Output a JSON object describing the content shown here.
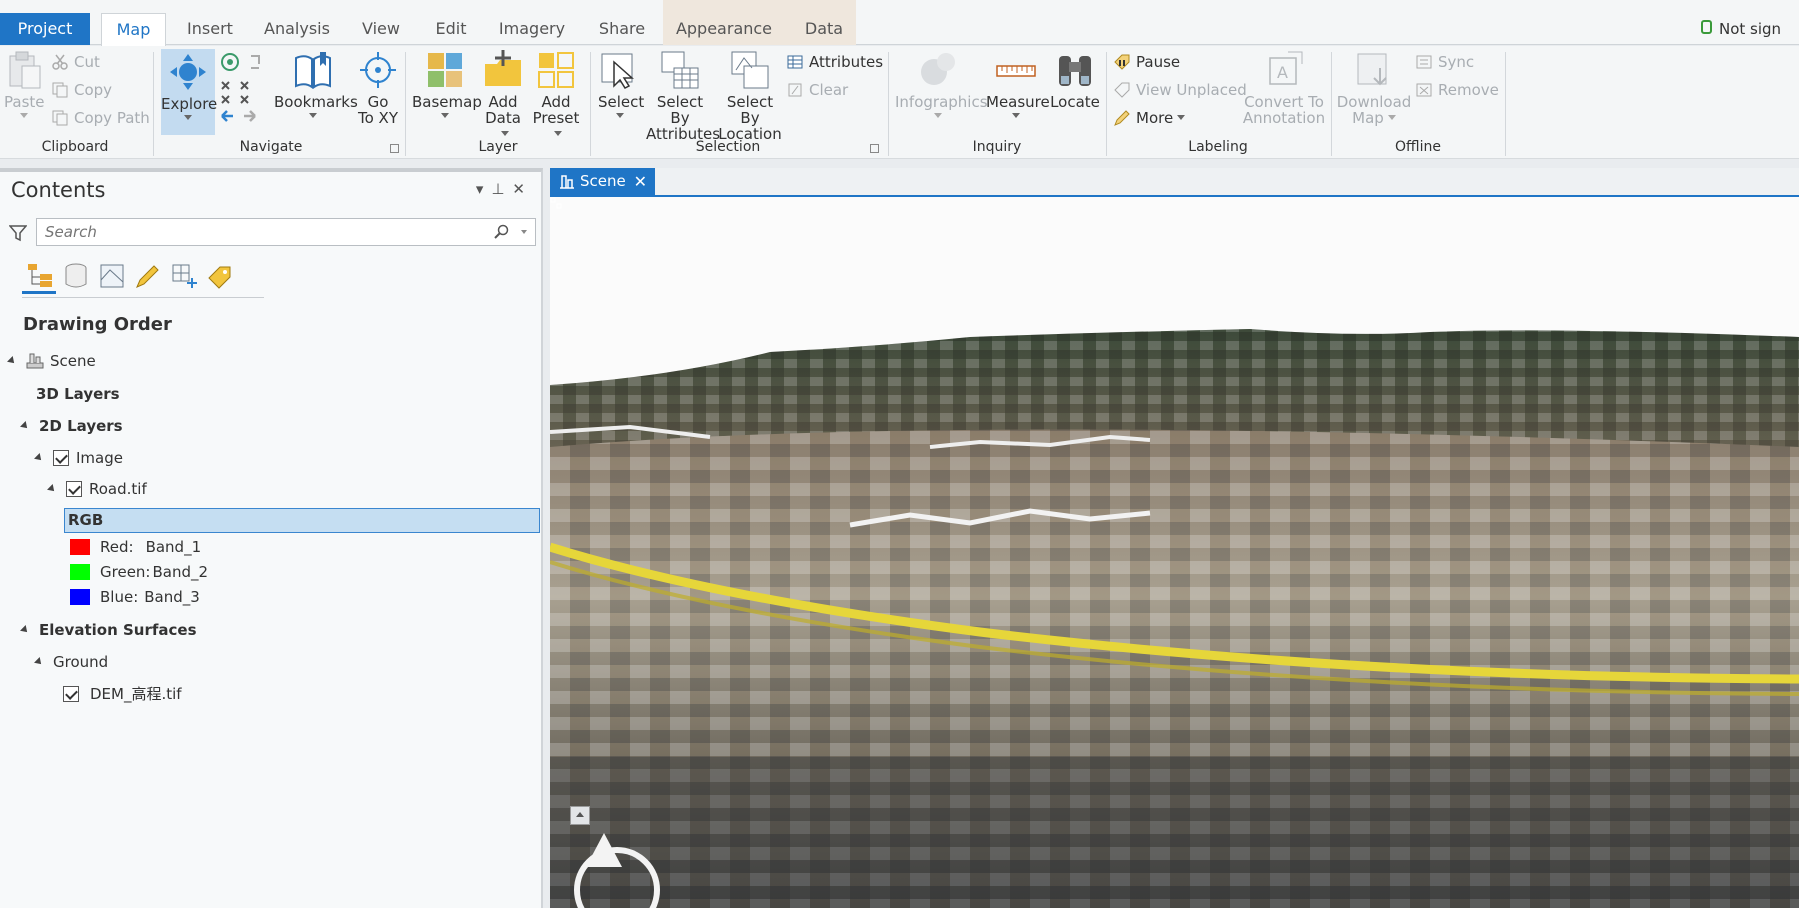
{
  "ribbon_tabs": {
    "project": "Project",
    "map": "Map",
    "insert": "Insert",
    "analysis": "Analysis",
    "view": "View",
    "edit": "Edit",
    "imagery": "Imagery",
    "share": "Share",
    "appearance": "Appearance",
    "data": "Data",
    "signin": "Not sign"
  },
  "clipboard": {
    "paste": "Paste",
    "cut": "Cut",
    "copy": "Copy",
    "copy_path": "Copy Path",
    "label": "Clipboard"
  },
  "navigate": {
    "explore": "Explore",
    "bookmarks": "Bookmarks",
    "go_to_xy_1": "Go",
    "go_to_xy_2": "To XY",
    "label": "Navigate"
  },
  "layer": {
    "basemap": "Basemap",
    "add_data_1": "Add",
    "add_data_2": "Data",
    "add_preset_1": "Add",
    "add_preset_2": "Preset",
    "label": "Layer"
  },
  "selection": {
    "select": "Select",
    "select_by_attr_1": "Select By",
    "select_by_attr_2": "Attributes",
    "select_by_loc_1": "Select By",
    "select_by_loc_2": "Location",
    "attributes": "Attributes",
    "clear": "Clear",
    "label": "Selection"
  },
  "inquiry": {
    "infographics": "Infographics",
    "measure": "Measure",
    "locate": "Locate",
    "label": "Inquiry"
  },
  "labeling": {
    "pause": "Pause",
    "view_unplaced": "View Unplaced",
    "more": "More",
    "convert_1": "Convert To",
    "convert_2": "Annotation",
    "label": "Labeling"
  },
  "offline": {
    "download_1": "Download",
    "download_2": "Map",
    "sync": "Sync",
    "remove": "Remove",
    "label": "Offline"
  },
  "contents": {
    "title": "Contents",
    "search_placeholder": "Search",
    "drawing_order": "Drawing Order",
    "tree": {
      "scene": "Scene",
      "layers_3d": "3D Layers",
      "layers_2d": "2D Layers",
      "image": "Image",
      "road": "Road.tif",
      "rgb": "RGB",
      "bands": [
        {
          "label": "Red:",
          "value": "Band_1",
          "color": "#ff0000"
        },
        {
          "label": "Green:",
          "value": "Band_2",
          "color": "#00ff00"
        },
        {
          "label": "Blue:",
          "value": "Band_3",
          "color": "#0000ff"
        }
      ],
      "elevation": "Elevation Surfaces",
      "ground": "Ground",
      "dem": "DEM_高程.tif"
    }
  },
  "scene_view": {
    "tab_label": "Scene",
    "accent": "#1f75c6"
  }
}
